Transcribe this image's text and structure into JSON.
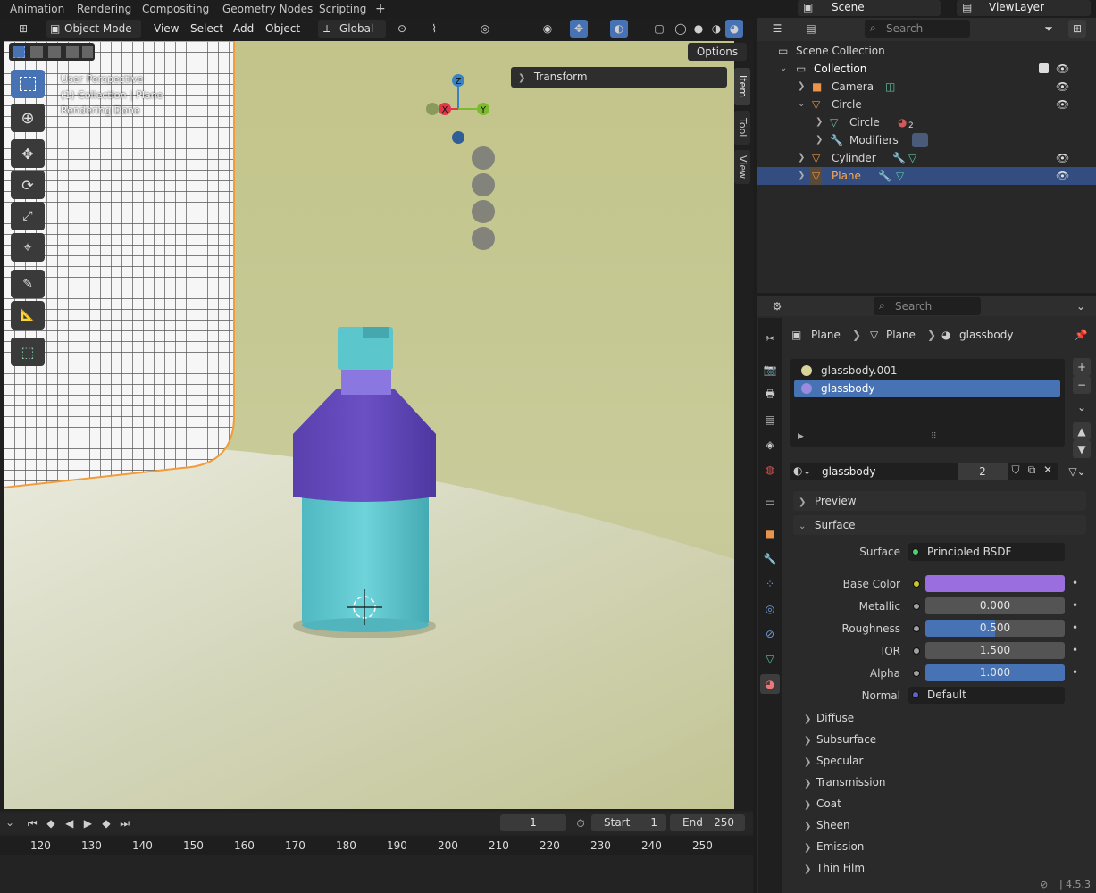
{
  "workspace_tabs": [
    "Animation",
    "Rendering",
    "Compositing",
    "Geometry Nodes",
    "Scripting"
  ],
  "add_workspace": "+",
  "scene_name": "Scene",
  "view_layer": "ViewLayer",
  "viewport": {
    "mode": "Object Mode",
    "menus": [
      "View",
      "Select",
      "Add",
      "Object"
    ],
    "orientation": "Global",
    "options_label": "Options",
    "info_lines": [
      "User Perspective",
      "(1) Collection | Plane",
      "Rendering Done"
    ],
    "transform_panel": "Transform",
    "side_tabs": [
      "Item",
      "Tool",
      "View"
    ],
    "gizmo_axes": {
      "x": "X",
      "y": "Y",
      "z": "Z"
    },
    "colors": {
      "x_axis": "#e0384a",
      "y_axis": "#7dbb2e",
      "z_axis": "#3a82c4",
      "bottle_cap": "#5ac6cc",
      "bottle_shoulder": "#6a4fc0",
      "bottle_body": "#5cc7d0",
      "backdrop": "#c8ca8e"
    }
  },
  "timeline": {
    "current_frame": "1",
    "start_label": "Start",
    "start": "1",
    "end_label": "End",
    "end": "250",
    "ruler": [
      "120",
      "130",
      "140",
      "150",
      "160",
      "170",
      "180",
      "190",
      "200",
      "210",
      "220",
      "230",
      "240",
      "250"
    ]
  },
  "outliner": {
    "search_placeholder": "Search",
    "root": "Scene Collection",
    "items": [
      {
        "label": "Collection",
        "level": 1
      },
      {
        "label": "Camera",
        "level": 2
      },
      {
        "label": "Circle",
        "level": 2
      },
      {
        "label": "Circle",
        "level": 3,
        "badge": "2"
      },
      {
        "label": "Modifiers",
        "level": 3
      },
      {
        "label": "Cylinder",
        "level": 2
      },
      {
        "label": "Plane",
        "level": 2,
        "selected": true
      }
    ]
  },
  "properties": {
    "search_placeholder": "Search",
    "breadcrumb": [
      "Plane",
      "Plane",
      "glassbody"
    ],
    "material_slots": [
      "glassbody.001",
      "glassbody"
    ],
    "selected_slot": "glassbody",
    "material_name": "glassbody",
    "user_count": "2",
    "sections": {
      "preview": "Preview",
      "surface": "Surface"
    },
    "surface_field_label": "Surface",
    "surface_shader": "Principled BSDF",
    "params": [
      {
        "label": "Base Color",
        "value": "",
        "type": "color",
        "color": "#9b6ee0"
      },
      {
        "label": "Metallic",
        "value": "0.000",
        "fill": 0
      },
      {
        "label": "Roughness",
        "value": "0.500",
        "fill": 0.5
      },
      {
        "label": "IOR",
        "value": "1.500",
        "fill": 0
      },
      {
        "label": "Alpha",
        "value": "1.000",
        "fill": 1
      },
      {
        "label": "Normal",
        "value": "Default",
        "type": "enum"
      }
    ],
    "subsections": [
      "Diffuse",
      "Subsurface",
      "Specular",
      "Transmission",
      "Coat",
      "Sheen",
      "Emission",
      "Thin Film"
    ]
  },
  "status_bar": {
    "version": "4.5.3"
  }
}
